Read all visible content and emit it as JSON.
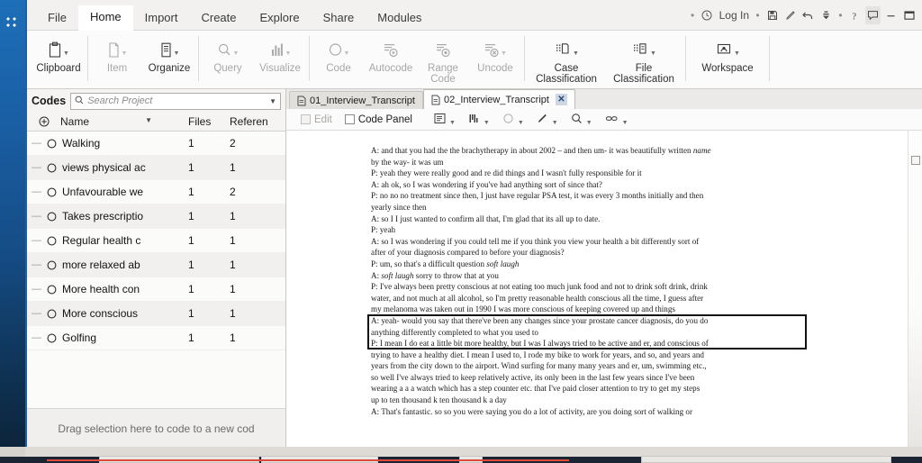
{
  "app": {
    "rail_icon": "move-grip-icon"
  },
  "menubar": {
    "items": [
      {
        "label": "File",
        "active": false
      },
      {
        "label": "Home",
        "active": true
      },
      {
        "label": "Import",
        "active": false
      },
      {
        "label": "Create",
        "active": false
      },
      {
        "label": "Explore",
        "active": false
      },
      {
        "label": "Share",
        "active": false
      },
      {
        "label": "Modules",
        "active": false
      }
    ],
    "right": {
      "login_label": "Log In",
      "icons": [
        "clock-icon",
        "save-icon",
        "pencil-icon",
        "undo-icon",
        "redo-dropdown-icon",
        "help-icon",
        "chat-icon",
        "minimize-icon",
        "maximize-icon"
      ]
    }
  },
  "ribbon": {
    "groups": [
      {
        "buttons": [
          {
            "label": "Clipboard",
            "icon": "clipboard-icon",
            "dim": false,
            "caret": true
          }
        ]
      },
      {
        "buttons": [
          {
            "label": "Item",
            "icon": "document-icon",
            "dim": true,
            "caret": true
          },
          {
            "label": "Organize",
            "icon": "organize-icon",
            "dim": false,
            "caret": true
          }
        ]
      },
      {
        "buttons": [
          {
            "label": "Query",
            "icon": "magnifier-icon",
            "dim": true,
            "caret": true
          },
          {
            "label": "Visualize",
            "icon": "bar-chart-icon",
            "dim": true,
            "caret": true
          }
        ]
      },
      {
        "buttons": [
          {
            "label": "Code",
            "icon": "circle-icon",
            "dim": true,
            "caret": true
          },
          {
            "label": "Autocode",
            "icon": "autocode-icon",
            "dim": true,
            "caret": false
          },
          {
            "label": "Range Code",
            "icon": "range-code-icon",
            "dim": true,
            "caret": false
          },
          {
            "label": "Uncode",
            "icon": "uncode-icon",
            "dim": true,
            "caret": true
          }
        ]
      },
      {
        "buttons": [
          {
            "label": "Case Classification",
            "icon": "case-classification-icon",
            "dim": false,
            "caret": true
          },
          {
            "label": "File Classification",
            "icon": "file-classification-icon",
            "dim": false,
            "caret": true
          }
        ]
      },
      {
        "buttons": [
          {
            "label": "Workspace",
            "icon": "workspace-icon",
            "dim": false,
            "caret": true
          }
        ]
      }
    ]
  },
  "codes_pane": {
    "title": "Codes",
    "search": {
      "placeholder": "Search Project",
      "value": ""
    },
    "columns": {
      "name": "Name",
      "files": "Files",
      "references": "Referen"
    },
    "rows": [
      {
        "name": "Walking",
        "files": "1",
        "references": "2"
      },
      {
        "name": "views physical ac",
        "files": "1",
        "references": "1"
      },
      {
        "name": "Unfavourable we",
        "files": "1",
        "references": "2"
      },
      {
        "name": "Takes prescriptio",
        "files": "1",
        "references": "1"
      },
      {
        "name": "Regular health c",
        "files": "1",
        "references": "1"
      },
      {
        "name": "more relaxed ab",
        "files": "1",
        "references": "1"
      },
      {
        "name": "More health con",
        "files": "1",
        "references": "1"
      },
      {
        "name": "More conscious",
        "files": "1",
        "references": "1"
      },
      {
        "name": "Golfing",
        "files": "1",
        "references": "1"
      }
    ],
    "dropzone_text": "Drag selection here to code to a new cod"
  },
  "document_pane": {
    "tabs": [
      {
        "label": "01_Interview_Transcript",
        "active": false,
        "closable": false
      },
      {
        "label": "02_Interview_Transcript",
        "active": true,
        "closable": true
      }
    ],
    "close_glyph": "✕",
    "toolbar": [
      {
        "label": "Edit",
        "type": "checkbox",
        "dim": true
      },
      {
        "label": "Code Panel",
        "type": "checkbox",
        "dim": false
      },
      {
        "label": "",
        "type": "icon",
        "icon": "text-panel-icon",
        "dim": false
      },
      {
        "label": "",
        "type": "icon",
        "icon": "coding-stripes-icon",
        "dim": false
      },
      {
        "label": "",
        "type": "icon",
        "icon": "circle-icon",
        "dim": true
      },
      {
        "label": "",
        "type": "icon",
        "icon": "highlight-pen-icon",
        "dim": false
      },
      {
        "label": "",
        "type": "icon",
        "icon": "zoom-icon",
        "dim": false
      },
      {
        "label": "",
        "type": "icon",
        "icon": "link-icon",
        "dim": false
      }
    ],
    "transcript_part1": "A: and that you had the the brachytherapy in about 2002 – and then um- it was beautifully written ",
    "transcript_name_italic": "name",
    "transcript_part2": "\nby the way- it was um\nP: yeah they were really good and re did things and I wasn't fully responsible for it\nA: ah ok, so I was wondering if you've had anything sort of since that?\nP: no no no treatment since then, I just have regular PSA test, it was every 3 months initially and then\nyearly since then\nA: so I I just wanted to confirm all that, I'm glad that its all up to date.\nP: yeah\nA: so I was wondering if you could tell me if you think you view your health a bit differently sort of\nafter of your diagnosis compared to before your diagnosis?\nP: um, so that's a difficult question ",
    "soft_laugh_1": "soft laugh",
    "transcript_part3": "\nA: ",
    "soft_laugh_2": "soft laugh",
    "transcript_part4": " sorry to throw that at you\nP: I've always been pretty conscious at not eating too much junk food and not to drink soft drink, drink\nwater, and not much at all alcohol, so I'm pretty reasonable health conscious all the time, I guess after\nmy melanoma was taken out in 1990 I was more conscious of keeping covered up and things\nA: yeah- would you say that there've been any changes since your prostate cancer diagnosis, do you do\nanything differently completed to what you used to\nP: I mean I do eat a little bit more healthy, but I was I always tried to be active and er, and conscious of\ntrying to have a healthy diet. I mean I used to, I rode my bike to work for years, and so, and years and\nyears from the city down to the airport. Wind surfing for many many years and er, um, swimming etc.,\nso well I've always tried to keep relatively active, its only been in the last few years since I've been\nwearing a a a watch which has a step counter etc. that I've paid closer attention to try to get my steps\nup to ten thousand k ten thousand k a day\nA: That's fantastic. so so you were saying you do a lot of activity, are you doing sort of walking or",
    "cursor": {
      "type": "i-beam",
      "highlight_color": "#ffef14"
    }
  },
  "colors": {
    "rail_top": "#1d6fb8",
    "rail_bottom": "#0c2135",
    "accent_blue": "#1f5fa6",
    "cursor_yellow": "#ffef14",
    "coded_box_border": "#111111",
    "taskbar_red": "#e0493c"
  }
}
